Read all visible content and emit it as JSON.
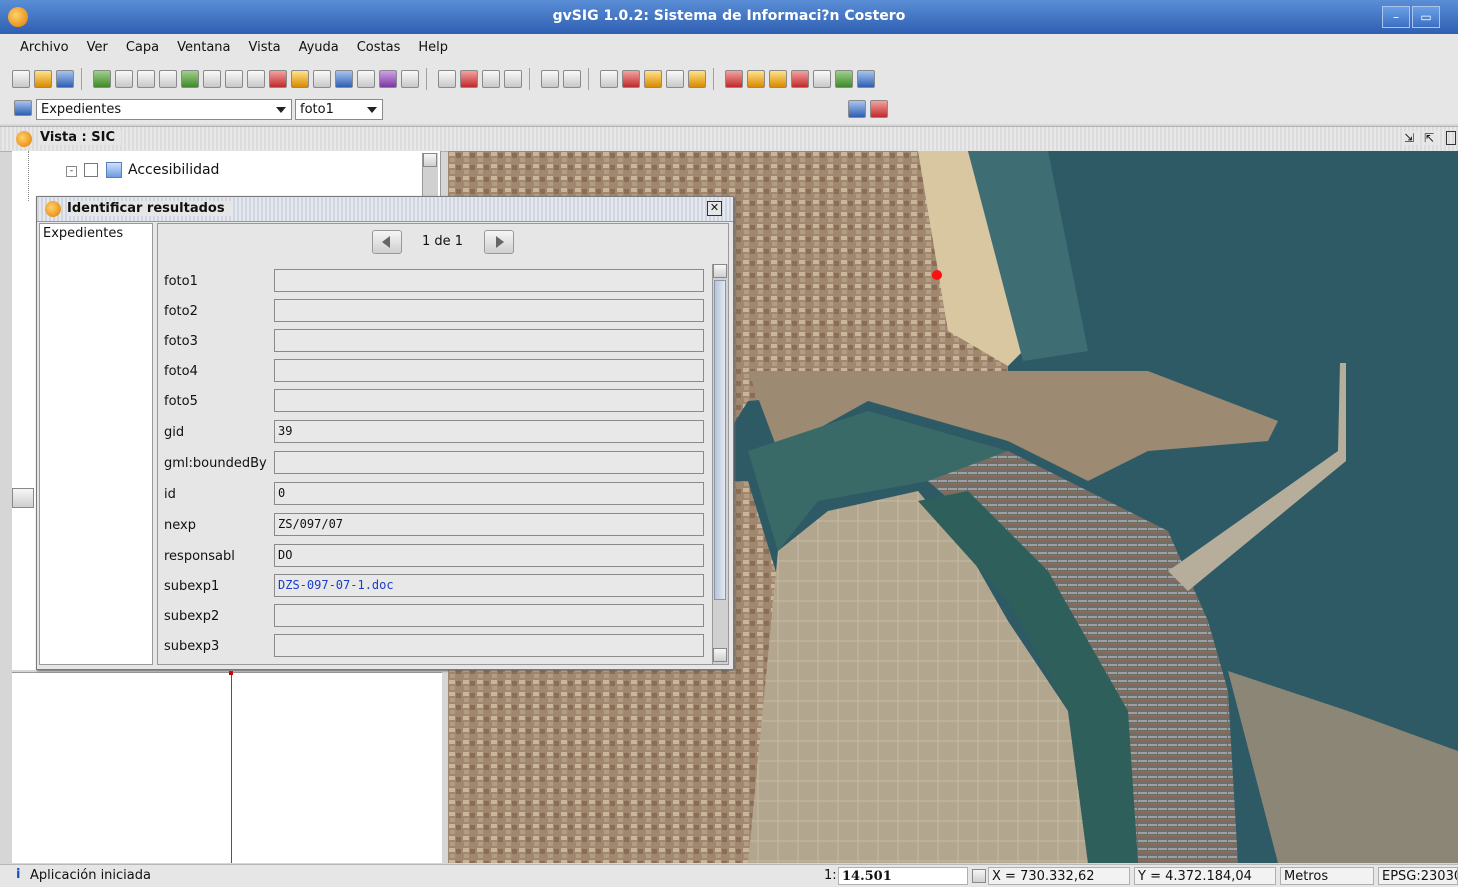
{
  "window": {
    "title": "gvSIG 1.0.2: Sistema de Informaci?n Costero"
  },
  "menu": [
    "Archivo",
    "Ver",
    "Capa",
    "Ventana",
    "Vista",
    "Ayuda",
    "Costas",
    "Help"
  ],
  "toolbar": {
    "icons": [
      "new-icon",
      "open-icon",
      "save-icon",
      "layers-icon",
      "zoom-in-icon",
      "zoom-out-icon",
      "zoom-full-icon",
      "zoom-layer-icon",
      "zoom-select-icon",
      "pan-icon",
      "info-icon",
      "measure-icon",
      "select-icon",
      "edit-icon"
    ]
  },
  "combos": {
    "layer": "Expedientes",
    "field": "foto1"
  },
  "view": {
    "title": "Vista : SIC"
  },
  "toc": {
    "layer_name": "Accesibilidad"
  },
  "dialog": {
    "title": "Identificar resultados",
    "layer_list": [
      "Expedientes"
    ],
    "pager": "1 de 1",
    "rows": [
      {
        "label": "foto1",
        "value": ""
      },
      {
        "label": "foto2",
        "value": ""
      },
      {
        "label": "foto3",
        "value": ""
      },
      {
        "label": "foto4",
        "value": ""
      },
      {
        "label": "foto5",
        "value": ""
      },
      {
        "label": "gid",
        "value": "39"
      },
      {
        "label": "gml:boundedBy",
        "value": ""
      },
      {
        "label": "id",
        "value": "0"
      },
      {
        "label": "nexp",
        "value": "ZS/097/07"
      },
      {
        "label": "responsabl",
        "value": "DO"
      },
      {
        "label": "subexp1",
        "value": "DZS-097-07-1.doc"
      },
      {
        "label": "subexp2",
        "value": ""
      },
      {
        "label": "subexp3",
        "value": ""
      }
    ],
    "link_color": "#1a3ec8"
  },
  "status": {
    "message": "Aplicación iniciada",
    "scale_prefix": "1:",
    "scale": "14.501",
    "x": "X = 730.332,62",
    "y": "Y = 4.372.184,04",
    "units": "Metros",
    "epsg": "EPSG:23030"
  },
  "colors": {
    "titlebar": "#3c6fc2",
    "sea": "#2e5a66",
    "land": "#9c8a72",
    "selected_point": "#ff1010"
  }
}
